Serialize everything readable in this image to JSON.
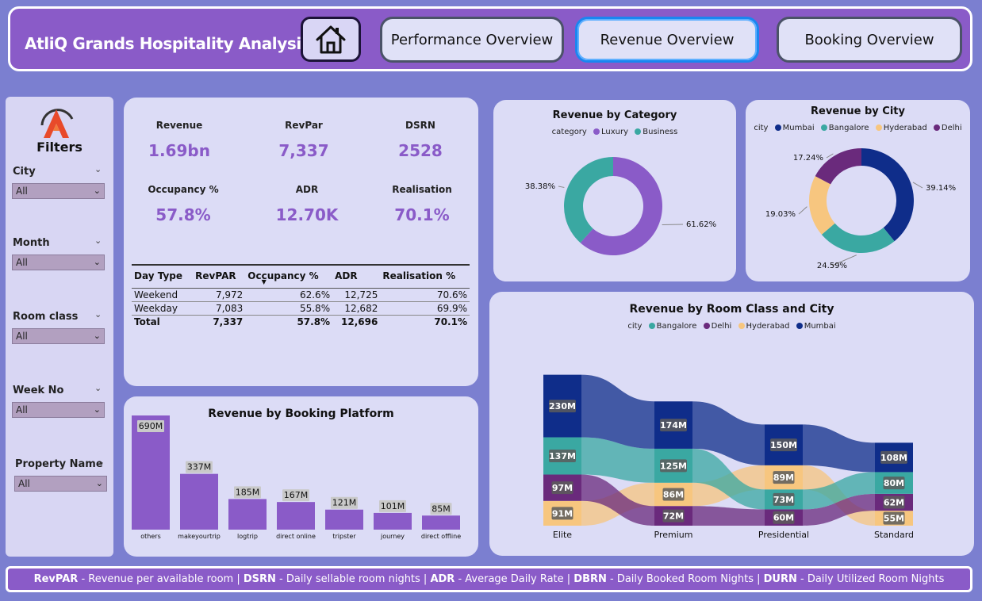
{
  "header": {
    "title": "AtliQ Grands Hospitality Analysis",
    "nav": [
      "Performance Overview",
      "Revenue Overview",
      "Booking Overview"
    ],
    "active_tab": "Revenue Overview"
  },
  "filters": {
    "title": "Filters",
    "items": [
      {
        "label": "City",
        "value": "All"
      },
      {
        "label": "Month",
        "value": "All"
      },
      {
        "label": "Room class",
        "value": "All"
      },
      {
        "label": "Week No",
        "value": "All"
      },
      {
        "label": "Property Name",
        "value": "All"
      }
    ]
  },
  "kpis": [
    {
      "label": "Revenue",
      "value": "1.69bn"
    },
    {
      "label": "RevPar",
      "value": "7,337"
    },
    {
      "label": "DSRN",
      "value": "2528"
    },
    {
      "label": "Occupancy %",
      "value": "57.8%"
    },
    {
      "label": "ADR",
      "value": "12.70K"
    },
    {
      "label": "Realisation",
      "value": "70.1%"
    }
  ],
  "daytype_table": {
    "columns": [
      "Day Type",
      "RevPAR",
      "Occupancy %",
      "ADR",
      "Realisation %"
    ],
    "rows": [
      [
        "Weekend",
        "7,972",
        "62.6%",
        "12,725",
        "70.6%"
      ],
      [
        "Weekday",
        "7,083",
        "55.8%",
        "12,682",
        "69.9%"
      ]
    ],
    "total": [
      "Total",
      "7,337",
      "57.8%",
      "12,696",
      "70.1%"
    ]
  },
  "colors": {
    "purple": "#8a5bc8",
    "teal": "#3aa8a2",
    "navy": "#0f2d8a",
    "dark_purple": "#6a2a7c",
    "peach": "#f7c67f"
  },
  "chart_data": [
    {
      "type": "bar",
      "title": "Revenue by Booking Platform",
      "categories": [
        "others",
        "makeyourtrip",
        "logtrip",
        "direct online",
        "tripster",
        "journey",
        "direct offline"
      ],
      "values": [
        690,
        337,
        185,
        167,
        121,
        101,
        85
      ],
      "labels": [
        "690M",
        "337M",
        "185M",
        "167M",
        "121M",
        "101M",
        "85M"
      ]
    },
    {
      "type": "pie",
      "title": "Revenue by Category",
      "legend_title": "category",
      "categories": [
        "Luxury",
        "Business"
      ],
      "values": [
        61.62,
        38.38
      ],
      "labels": [
        "61.62%",
        "38.38%"
      ],
      "colors": [
        "#8a5bc8",
        "#3aa8a2"
      ]
    },
    {
      "type": "pie",
      "title": "Revenue by City",
      "legend_title": "city",
      "categories": [
        "Mumbai",
        "Bangalore",
        "Hyderabad",
        "Delhi"
      ],
      "values": [
        39.14,
        24.59,
        19.03,
        17.24
      ],
      "labels": [
        "39.14%",
        "24.59%",
        "19.03%",
        "17.24%"
      ],
      "colors": [
        "#0f2d8a",
        "#3aa8a2",
        "#f7c67f",
        "#6a2a7c"
      ]
    },
    {
      "type": "bar",
      "title": "Revenue by Room Class and City",
      "legend_title": "city",
      "categories": [
        "Elite",
        "Premium",
        "Presidential",
        "Standard"
      ],
      "series": [
        {
          "name": "Mumbai",
          "color": "#0f2d8a",
          "values": [
            230,
            174,
            150,
            108
          ],
          "labels": [
            "230M",
            "174M",
            "150M",
            "108M"
          ]
        },
        {
          "name": "Bangalore",
          "color": "#3aa8a2",
          "values": [
            137,
            125,
            73,
            80
          ],
          "labels": [
            "137M",
            "125M",
            "73M",
            "80M"
          ]
        },
        {
          "name": "Delhi",
          "color": "#6a2a7c",
          "values": [
            97,
            72,
            60,
            62
          ],
          "labels": [
            "97M",
            "72M",
            "60M",
            "62M"
          ]
        },
        {
          "name": "Hyderabad",
          "color": "#f7c67f",
          "values": [
            91,
            86,
            89,
            55
          ],
          "labels": [
            "91M",
            "86M",
            "89M",
            "55M"
          ]
        }
      ]
    }
  ],
  "footer": [
    {
      "term": "RevPAR",
      "def": " - Revenue per available room | "
    },
    {
      "term": "DSRN",
      "def": " - Daily sellable room nights | "
    },
    {
      "term": "ADR",
      "def": " - Average Daily Rate | "
    },
    {
      "term": "DBRN",
      "def": " - Daily Booked Room Nights | "
    },
    {
      "term": "DURN",
      "def": " - Daily Utilized Room Nights"
    }
  ]
}
